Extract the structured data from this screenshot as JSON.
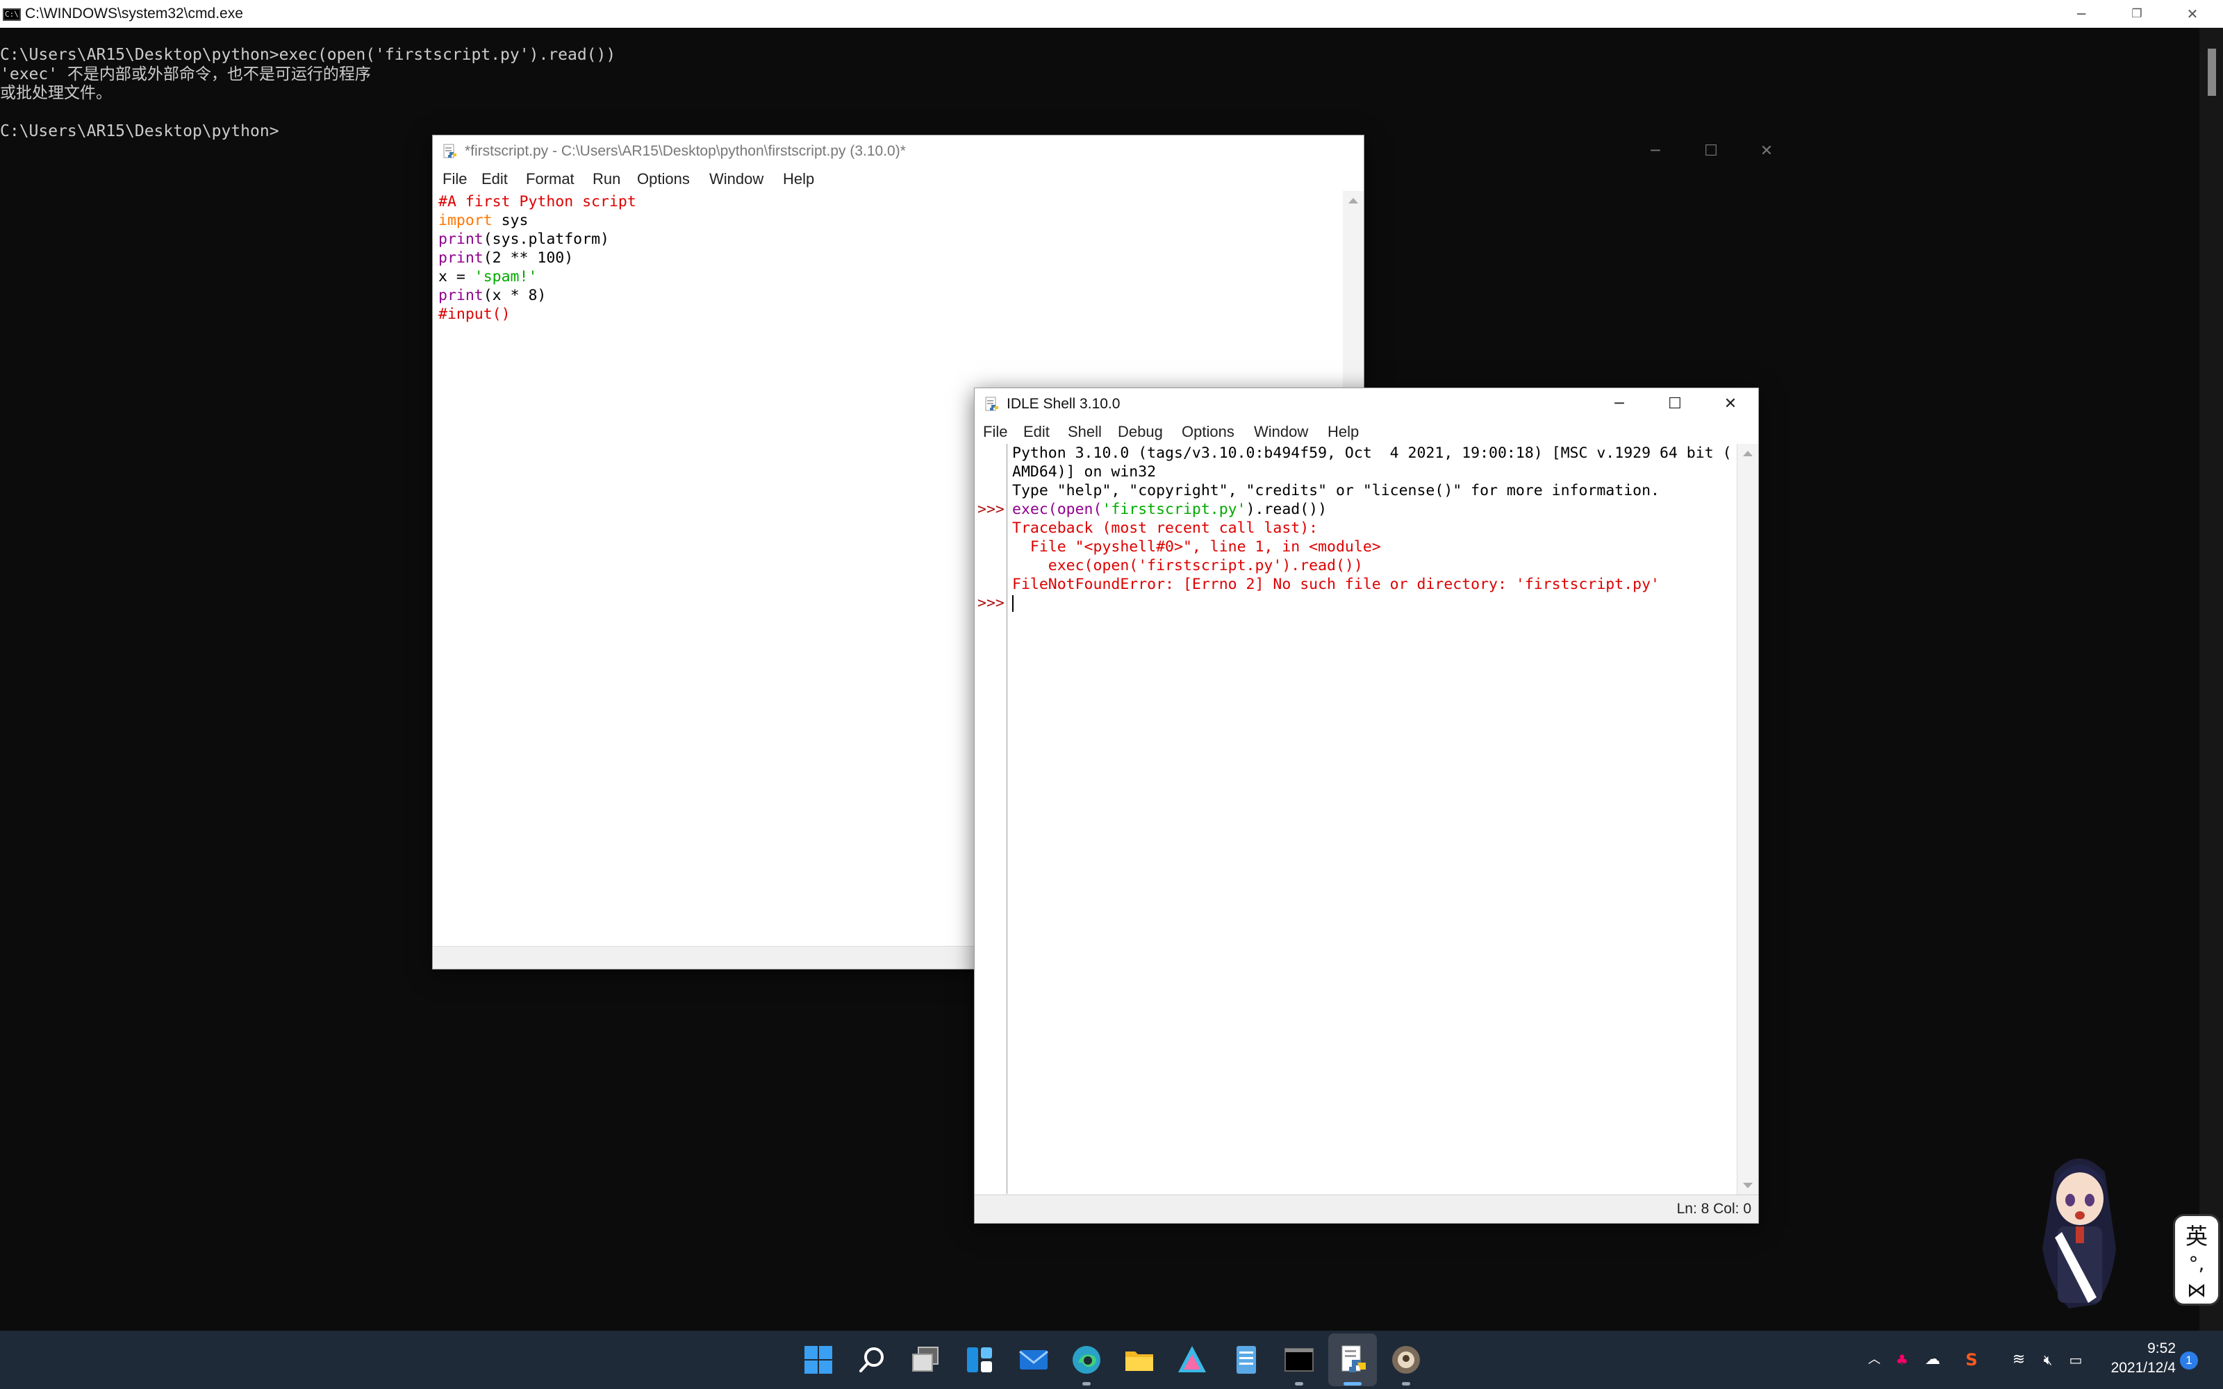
{
  "cmd": {
    "title": "C:\\WINDOWS\\system32\\cmd.exe",
    "lines": [
      "C:\\Users\\AR15\\Desktop\\python>exec(open('firstscript.py').read())",
      "'exec' 不是内部或外部命令，也不是可运行的程序",
      "或批处理文件。",
      "",
      "C:\\Users\\AR15\\Desktop\\python>"
    ]
  },
  "editor": {
    "title": "*firstscript.py - C:\\Users\\AR15\\Desktop\\python\\firstscript.py (3.10.0)*",
    "menu": [
      "File",
      "Edit",
      "Format",
      "Run",
      "Options",
      "Window",
      "Help"
    ],
    "code": {
      "l1": "#A first Python script",
      "l2_kw": "import",
      "l2_rest": " sys",
      "l3_kw": "print",
      "l3_rest": "(sys.platform)",
      "l4_kw": "print",
      "l4_rest": "(2 ** 100)",
      "l5_pre": "x = ",
      "l5_str": "'spam!'",
      "l6_kw": "print",
      "l6_rest": "(x * 8)",
      "l7": "#input()"
    }
  },
  "shell": {
    "title": "IDLE Shell 3.10.0",
    "menu": [
      "File",
      "Edit",
      "Shell",
      "Debug",
      "Options",
      "Window",
      "Help"
    ],
    "prompts": {
      "p1": ">>>",
      "p2": ">>>"
    },
    "banner1": "Python 3.10.0 (tags/v3.10.0:b494f59, Oct  4 2021, 19:00:18) [MSC v.1929 64 bit (",
    "banner2": "AMD64)] on win32",
    "banner3": "Type \"help\", \"copyright\", \"credits\" or \"license()\" for more information.",
    "cmd_pre": "exec(open(",
    "cmd_str": "'firstscript.py'",
    "cmd_post": ").read())",
    "tb1": "Traceback (most recent call last):",
    "tb2": "  File \"<pyshell#0>\", line 1, in <module>",
    "tb3": "    exec(open('firstscript.py').read())",
    "tb4": "FileNotFoundError: [Errno 2] No such file or directory: 'firstscript.py'",
    "status": "Ln: 8   Col: 0"
  },
  "taskbar": {
    "clock_time": "9:52",
    "clock_date": "2021/12/4",
    "notification_count": "1",
    "icons": [
      "windows-start-icon",
      "search-icon",
      "task-view-icon",
      "widgets-icon",
      "mail-icon",
      "edge-icon",
      "file-explorer-icon",
      "app-icon",
      "notepad-icon",
      "terminal-icon",
      "idle-icon",
      "idle-app-icon"
    ]
  },
  "ime": {
    "char": "英"
  },
  "colors": {
    "idle_keyword": "#ff7700",
    "idle_builtin": "#900090",
    "idle_string": "#00aa00",
    "idle_comment": "#dd0000",
    "idle_error": "#dd0000",
    "taskbar_bg": "#1f2a38"
  }
}
